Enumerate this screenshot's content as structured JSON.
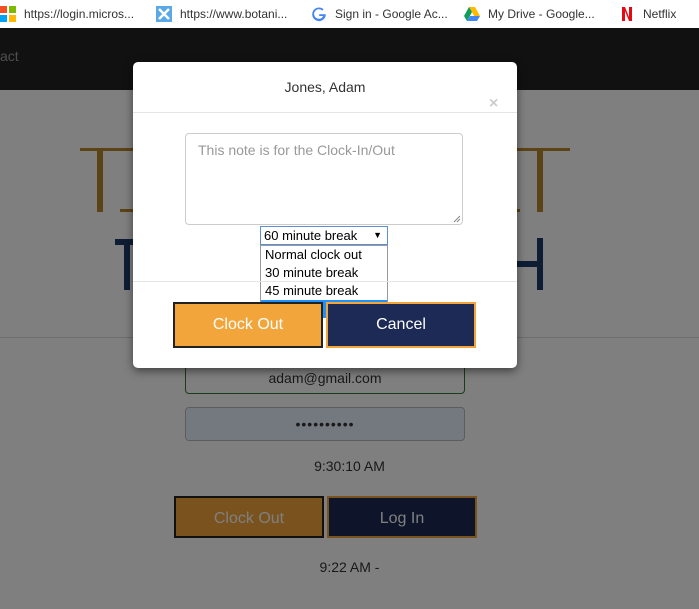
{
  "bookmarks": [
    {
      "label": "https://login.micros...",
      "icon": "microsoft-icon"
    },
    {
      "label": "https://www.botani...",
      "icon": "botani-icon"
    },
    {
      "label": "Sign in - Google Ac...",
      "icon": "google-icon"
    },
    {
      "label": "My Drive - Google...",
      "icon": "google-drive-icon"
    },
    {
      "label": "Netflix",
      "icon": "netflix-icon"
    }
  ],
  "navbar": {
    "partial_text": "act"
  },
  "form": {
    "email_value": "adam@gmail.com",
    "password_mask": "••••••••••",
    "current_time": "9:30:10 AM",
    "clock_out_label": "Clock Out",
    "login_label": "Log In",
    "last_time": "9:22 AM -"
  },
  "modal": {
    "title": "Jones, Adam",
    "close_label": "×",
    "note_placeholder": "This note is for the Clock-In/Out",
    "break_selected": "60 minute break",
    "break_options": [
      "Normal clock out",
      "30 minute break",
      "45 minute break",
      "60 minute break"
    ],
    "selected_index": 3,
    "clock_out_label": "Clock Out",
    "cancel_label": "Cancel"
  },
  "colors": {
    "accent_orange": "#f2a53a",
    "navy": "#1c2a55",
    "navbar": "#222222",
    "selection_blue": "#1e90ff"
  }
}
